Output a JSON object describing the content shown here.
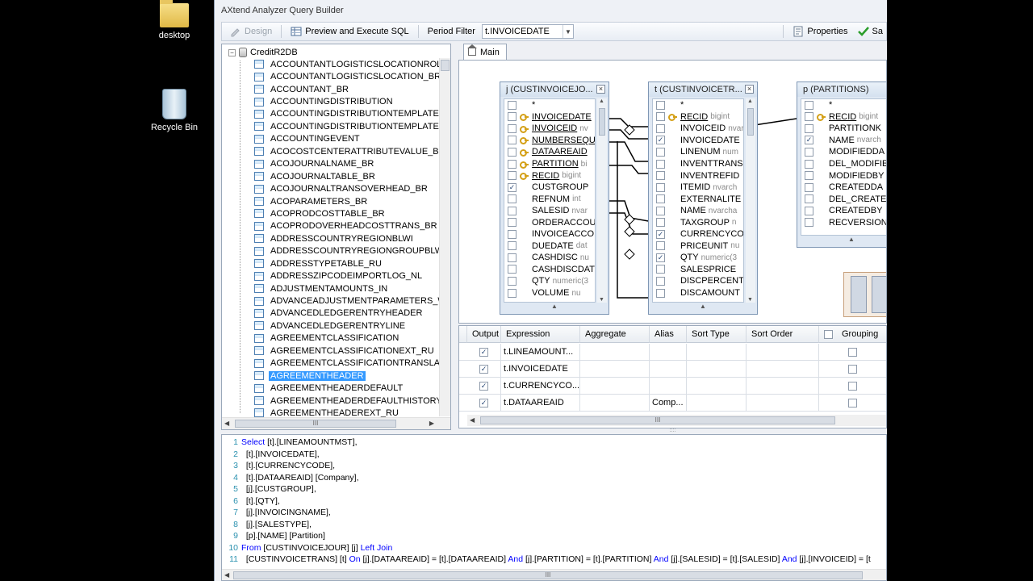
{
  "desktop": {
    "icons": [
      {
        "label": "desktop",
        "icon": "folder-icon"
      },
      {
        "label": "Recycle Bin",
        "icon": "recycle-bin-icon"
      }
    ]
  },
  "window": {
    "title": "AXtend Analyzer Query Builder"
  },
  "toolbar": {
    "design_label": "Design",
    "preview_label": "Preview and Execute SQL",
    "period_filter_label": "Period Filter",
    "period_filter_value": "t.INVOICEDATE",
    "properties_label": "Properties",
    "save_label": "Sa"
  },
  "tree": {
    "root": "CreditR2DB",
    "items": [
      "ACCOUNTANTLOGISTICSLOCATIONROLE_",
      "ACCOUNTANTLOGISTICSLOCATION_BR",
      "ACCOUNTANT_BR",
      "ACCOUNTINGDISTRIBUTION",
      "ACCOUNTINGDISTRIBUTIONTEMPLATE",
      "ACCOUNTINGDISTRIBUTIONTEMPLATEDE",
      "ACCOUNTINGEVENT",
      "ACOCOSTCENTERATTRIBUTEVALUE_BR",
      "ACOJOURNALNAME_BR",
      "ACOJOURNALTABLE_BR",
      "ACOJOURNALTRANSOVERHEAD_BR",
      "ACOPARAMETERS_BR",
      "ACOPRODCOSTTABLE_BR",
      "ACOPRODOVERHEADCOSTTRANS_BR",
      "ADDRESSCOUNTRYREGIONBLWI",
      "ADDRESSCOUNTRYREGIONGROUPBLWI",
      "ADDRESSTYPETABLE_RU",
      "ADDRESSZIPCODEIMPORTLOG_NL",
      "ADJUSTMENTAMOUNTS_IN",
      "ADVANCEADJUSTMENTPARAMETERS_W",
      "ADVANCEDLEDGERENTRYHEADER",
      "ADVANCEDLEDGERENTRYLINE",
      "AGREEMENTCLASSIFICATION",
      "AGREEMENTCLASSIFICATIONEXT_RU",
      "AGREEMENTCLASSIFICATIONTRANSLATIC",
      "AGREEMENTHEADER",
      "AGREEMENTHEADERDEFAULT",
      "AGREEMENTHEADERDEFAULTHISTORY",
      "AGREEMENTHEADEREXT_RU"
    ],
    "selected_item": "AGREEMENTHEADER",
    "hscroll_grip": "III"
  },
  "designer": {
    "tab_label": "Main",
    "tables": [
      {
        "title": "j (CUSTINVOICEJO...",
        "fields": [
          {
            "name": "*",
            "type": "",
            "pk": false,
            "checked": false
          },
          {
            "name": "INVOICEDATE",
            "type": "",
            "pk": true,
            "checked": false
          },
          {
            "name": "INVOICEID",
            "type": "nv",
            "pk": true,
            "checked": false
          },
          {
            "name": "NUMBERSEQU",
            "type": "",
            "pk": true,
            "checked": false
          },
          {
            "name": "DATAAREAID",
            "type": "",
            "pk": true,
            "checked": false
          },
          {
            "name": "PARTITION",
            "type": "bi",
            "pk": true,
            "checked": false
          },
          {
            "name": "RECID",
            "type": "bigint",
            "pk": true,
            "checked": false
          },
          {
            "name": "CUSTGROUP",
            "type": "",
            "pk": false,
            "checked": true
          },
          {
            "name": "REFNUM",
            "type": "int",
            "pk": false,
            "checked": false
          },
          {
            "name": "SALESID",
            "type": "nvar",
            "pk": false,
            "checked": false
          },
          {
            "name": "ORDERACCOU",
            "type": "",
            "pk": false,
            "checked": false
          },
          {
            "name": "INVOICEACCO",
            "type": "",
            "pk": false,
            "checked": false
          },
          {
            "name": "DUEDATE",
            "type": "dat",
            "pk": false,
            "checked": false
          },
          {
            "name": "CASHDISC",
            "type": "nu",
            "pk": false,
            "checked": false
          },
          {
            "name": "CASHDISCDAT",
            "type": "",
            "pk": false,
            "checked": false
          },
          {
            "name": "QTY",
            "type": "numeric(3",
            "pk": false,
            "checked": false
          },
          {
            "name": "VOLUME",
            "type": "nu",
            "pk": false,
            "checked": false
          }
        ]
      },
      {
        "title": "t (CUSTINVOICETR...",
        "fields": [
          {
            "name": "*",
            "type": "",
            "pk": false,
            "checked": false
          },
          {
            "name": "RECID",
            "type": "bigint",
            "pk": true,
            "checked": false
          },
          {
            "name": "INVOICEID",
            "type": "nvar",
            "pk": false,
            "checked": false
          },
          {
            "name": "INVOICEDATE",
            "type": "",
            "pk": false,
            "checked": true
          },
          {
            "name": "LINENUM",
            "type": "num",
            "pk": false,
            "checked": false
          },
          {
            "name": "INVENTTRANS",
            "type": "",
            "pk": false,
            "checked": false
          },
          {
            "name": "INVENTREFID",
            "type": "",
            "pk": false,
            "checked": false
          },
          {
            "name": "ITEMID",
            "type": "nvarch",
            "pk": false,
            "checked": false
          },
          {
            "name": "EXTERNALITE",
            "type": "",
            "pk": false,
            "checked": false
          },
          {
            "name": "NAME",
            "type": "nvarcha",
            "pk": false,
            "checked": false
          },
          {
            "name": "TAXGROUP",
            "type": "n",
            "pk": false,
            "checked": false
          },
          {
            "name": "CURRENCYCO",
            "type": "",
            "pk": false,
            "checked": true
          },
          {
            "name": "PRICEUNIT",
            "type": "nu",
            "pk": false,
            "checked": false
          },
          {
            "name": "QTY",
            "type": "numeric(3",
            "pk": false,
            "checked": true
          },
          {
            "name": "SALESPRICE",
            "type": "",
            "pk": false,
            "checked": false
          },
          {
            "name": "DISCPERCENT",
            "type": "",
            "pk": false,
            "checked": false
          },
          {
            "name": "DISCAMOUNT",
            "type": "",
            "pk": false,
            "checked": false
          }
        ]
      },
      {
        "title": "p (PARTITIONS)",
        "fields": [
          {
            "name": "*",
            "type": "",
            "pk": false,
            "checked": false
          },
          {
            "name": "RECID",
            "type": "bigint",
            "pk": true,
            "checked": false
          },
          {
            "name": "PARTITIONK",
            "type": "",
            "pk": false,
            "checked": false
          },
          {
            "name": "NAME",
            "type": "nvarch",
            "pk": false,
            "checked": true
          },
          {
            "name": "MODIFIEDDA",
            "type": "",
            "pk": false,
            "checked": false
          },
          {
            "name": "DEL_MODIFIE",
            "type": "",
            "pk": false,
            "checked": false
          },
          {
            "name": "MODIFIEDBY",
            "type": "",
            "pk": false,
            "checked": false
          },
          {
            "name": "CREATEDDA",
            "type": "",
            "pk": false,
            "checked": false
          },
          {
            "name": "DEL_CREATE",
            "type": "",
            "pk": false,
            "checked": false
          },
          {
            "name": "CREATEDBY",
            "type": "",
            "pk": false,
            "checked": false
          },
          {
            "name": "RECVERSION",
            "type": "",
            "pk": false,
            "checked": false
          }
        ]
      }
    ]
  },
  "grid": {
    "columns": [
      "Output",
      "Expression",
      "Aggregate",
      "Alias",
      "Sort Type",
      "Sort Order",
      "Grouping"
    ],
    "rows": [
      {
        "output": true,
        "expression": "t.LINEAMOUNT...",
        "aggregate": "",
        "alias": "",
        "sort_type": "",
        "sort_order": "",
        "grouping": false
      },
      {
        "output": true,
        "expression": "t.INVOICEDATE",
        "aggregate": "",
        "alias": "",
        "sort_type": "",
        "sort_order": "",
        "grouping": false
      },
      {
        "output": true,
        "expression": "t.CURRENCYCO...",
        "aggregate": "",
        "alias": "",
        "sort_type": "",
        "sort_order": "",
        "grouping": false
      },
      {
        "output": true,
        "expression": "t.DATAAREAID",
        "aggregate": "",
        "alias": "Comp...",
        "sort_type": "",
        "sort_order": "",
        "grouping": false
      }
    ],
    "hscroll_grip": "III"
  },
  "sql": {
    "lines": [
      {
        "num": "1",
        "parts": [
          {
            "kw": true,
            "t": "Select"
          },
          {
            "kw": false,
            "t": " [t].[LINEAMOUNTMST],"
          }
        ]
      },
      {
        "num": "2",
        "parts": [
          {
            "kw": false,
            "t": "  [t].[INVOICEDATE],"
          }
        ]
      },
      {
        "num": "3",
        "parts": [
          {
            "kw": false,
            "t": "  [t].[CURRENCYCODE],"
          }
        ]
      },
      {
        "num": "4",
        "parts": [
          {
            "kw": false,
            "t": "  [t].[DATAAREAID] [Company],"
          }
        ]
      },
      {
        "num": "5",
        "parts": [
          {
            "kw": false,
            "t": "  [j].[CUSTGROUP],"
          }
        ]
      },
      {
        "num": "6",
        "parts": [
          {
            "kw": false,
            "t": "  [t].[QTY],"
          }
        ]
      },
      {
        "num": "7",
        "parts": [
          {
            "kw": false,
            "t": "  [j].[INVOICINGNAME],"
          }
        ]
      },
      {
        "num": "8",
        "parts": [
          {
            "kw": false,
            "t": "  [j].[SALESTYPE],"
          }
        ]
      },
      {
        "num": "9",
        "parts": [
          {
            "kw": false,
            "t": "  [p].[NAME] [Partition]"
          }
        ]
      },
      {
        "num": "10",
        "parts": [
          {
            "kw": true,
            "t": "From"
          },
          {
            "kw": false,
            "t": " [CUSTINVOICEJOUR] [j] "
          },
          {
            "kw": true,
            "t": "Left Join"
          }
        ]
      },
      {
        "num": "11",
        "parts": [
          {
            "kw": false,
            "t": "  [CUSTINVOICETRANS] [t] "
          },
          {
            "kw": true,
            "t": "On"
          },
          {
            "kw": false,
            "t": " [j].[DATAAREAID] = [t].[DATAAREAID] "
          },
          {
            "kw": true,
            "t": "And"
          },
          {
            "kw": false,
            "t": " [j].[PARTITION] = [t].[PARTITION] "
          },
          {
            "kw": true,
            "t": "And"
          },
          {
            "kw": false,
            "t": " [j].[SALESID] = [t].[SALESID] "
          },
          {
            "kw": true,
            "t": "And"
          },
          {
            "kw": false,
            "t": " [j].[INVOICEID] = [t"
          }
        ]
      }
    ],
    "hscroll_grip": "III"
  }
}
